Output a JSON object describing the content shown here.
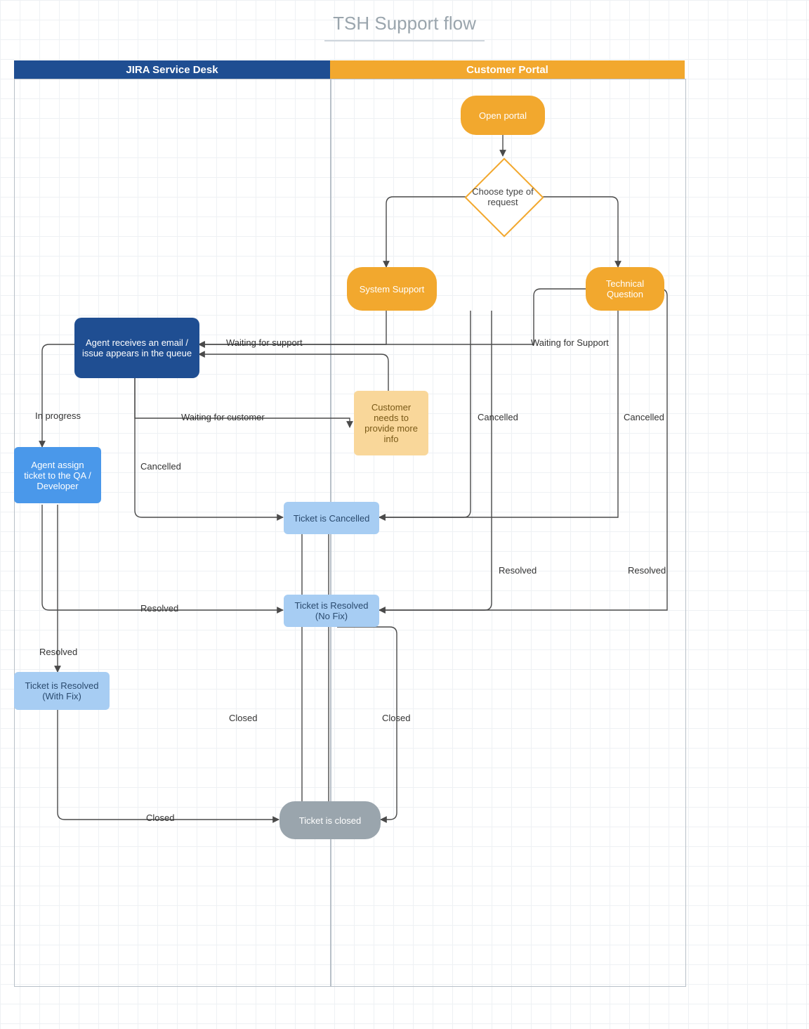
{
  "title": "TSH Support flow",
  "lanes": {
    "left": "JIRA Service Desk",
    "right": "Customer Portal"
  },
  "nodes": {
    "open_portal": "Open portal",
    "choose_type": "Choose type of request",
    "system_support": "System Support",
    "technical_question": "Technical Question",
    "agent_receives": "Agent receives an email / issue appears in the queue",
    "more_info": "Customer needs to provide more info",
    "assign_ticket": "Agent assign ticket to the QA / Developer",
    "cancelled": "Ticket is Cancelled",
    "resolved_no_fix": "Ticket is Resolved (No Fix)",
    "resolved_fix": "Ticket is Resolved (With Fix)",
    "closed": "Ticket is closed"
  },
  "edges": {
    "waiting_support_l": "Waiting for support",
    "waiting_support_r": "Waiting for Support",
    "waiting_customer": "Waiting for customer",
    "in_progress": "In progress",
    "cancelled": "Cancelled",
    "resolved": "Resolved",
    "closed": "Closed"
  },
  "colors": {
    "blue_dark": "#1f4e92",
    "orange": "#f2a82e",
    "orange_light": "#f9d79a",
    "blue_mid": "#4a98ea",
    "blue_light": "#a7cdf3",
    "gray": "#9aa5ad"
  },
  "chart_data": {
    "type": "flowchart",
    "title": "TSH Support flow",
    "swimlanes": [
      {
        "id": "jira",
        "label": "JIRA Service Desk"
      },
      {
        "id": "portal",
        "label": "Customer Portal"
      }
    ],
    "nodes": [
      {
        "id": "open_portal",
        "label": "Open portal",
        "lane": "portal",
        "shape": "rounded",
        "style": "orange"
      },
      {
        "id": "choose_type",
        "label": "Choose type of request",
        "lane": "portal",
        "shape": "diamond",
        "style": "orange-outline"
      },
      {
        "id": "system_support",
        "label": "System Support",
        "lane": "portal",
        "shape": "rounded",
        "style": "orange"
      },
      {
        "id": "technical_question",
        "label": "Technical Question",
        "lane": "portal",
        "shape": "rounded",
        "style": "orange"
      },
      {
        "id": "agent_receives",
        "label": "Agent receives an email / issue appears in the queue",
        "lane": "jira",
        "shape": "rounded",
        "style": "blue-dark"
      },
      {
        "id": "more_info",
        "label": "Customer needs to provide more info",
        "lane": "portal",
        "shape": "rect",
        "style": "orange-light"
      },
      {
        "id": "assign_ticket",
        "label": "Agent assign ticket to the QA / Developer",
        "lane": "jira",
        "shape": "rect",
        "style": "blue-mid"
      },
      {
        "id": "cancelled",
        "label": "Ticket is Cancelled",
        "lane": "boundary",
        "shape": "rect",
        "style": "blue-light"
      },
      {
        "id": "resolved_no_fix",
        "label": "Ticket is Resolved (No Fix)",
        "lane": "boundary",
        "shape": "rect",
        "style": "blue-light"
      },
      {
        "id": "resolved_fix",
        "label": "Ticket is Resolved (With Fix)",
        "lane": "jira",
        "shape": "rect",
        "style": "blue-light"
      },
      {
        "id": "closed",
        "label": "Ticket is closed",
        "lane": "boundary",
        "shape": "rounded",
        "style": "gray"
      }
    ],
    "edges": [
      {
        "from": "open_portal",
        "to": "choose_type",
        "label": ""
      },
      {
        "from": "choose_type",
        "to": "system_support",
        "label": ""
      },
      {
        "from": "choose_type",
        "to": "technical_question",
        "label": ""
      },
      {
        "from": "system_support",
        "to": "agent_receives",
        "label": "Waiting for support"
      },
      {
        "from": "technical_question",
        "to": "agent_receives",
        "label": "Waiting for Support"
      },
      {
        "from": "agent_receives",
        "to": "more_info",
        "label": "Waiting for customer"
      },
      {
        "from": "more_info",
        "to": "agent_receives",
        "label": ""
      },
      {
        "from": "agent_receives",
        "to": "assign_ticket",
        "label": "In progress"
      },
      {
        "from": "agent_receives",
        "to": "cancelled",
        "label": "Cancelled"
      },
      {
        "from": "system_support",
        "to": "cancelled",
        "label": "Cancelled"
      },
      {
        "from": "technical_question",
        "to": "cancelled",
        "label": "Cancelled"
      },
      {
        "from": "system_support",
        "to": "resolved_no_fix",
        "label": "Resolved"
      },
      {
        "from": "technical_question",
        "to": "resolved_no_fix",
        "label": "Resolved"
      },
      {
        "from": "assign_ticket",
        "to": "resolved_no_fix",
        "label": "Resolved"
      },
      {
        "from": "assign_ticket",
        "to": "resolved_fix",
        "label": "Resolved"
      },
      {
        "from": "cancelled",
        "to": "closed",
        "label": "Closed"
      },
      {
        "from": "resolved_no_fix",
        "to": "closed",
        "label": "Closed"
      },
      {
        "from": "resolved_fix",
        "to": "closed",
        "label": "Closed"
      }
    ]
  }
}
